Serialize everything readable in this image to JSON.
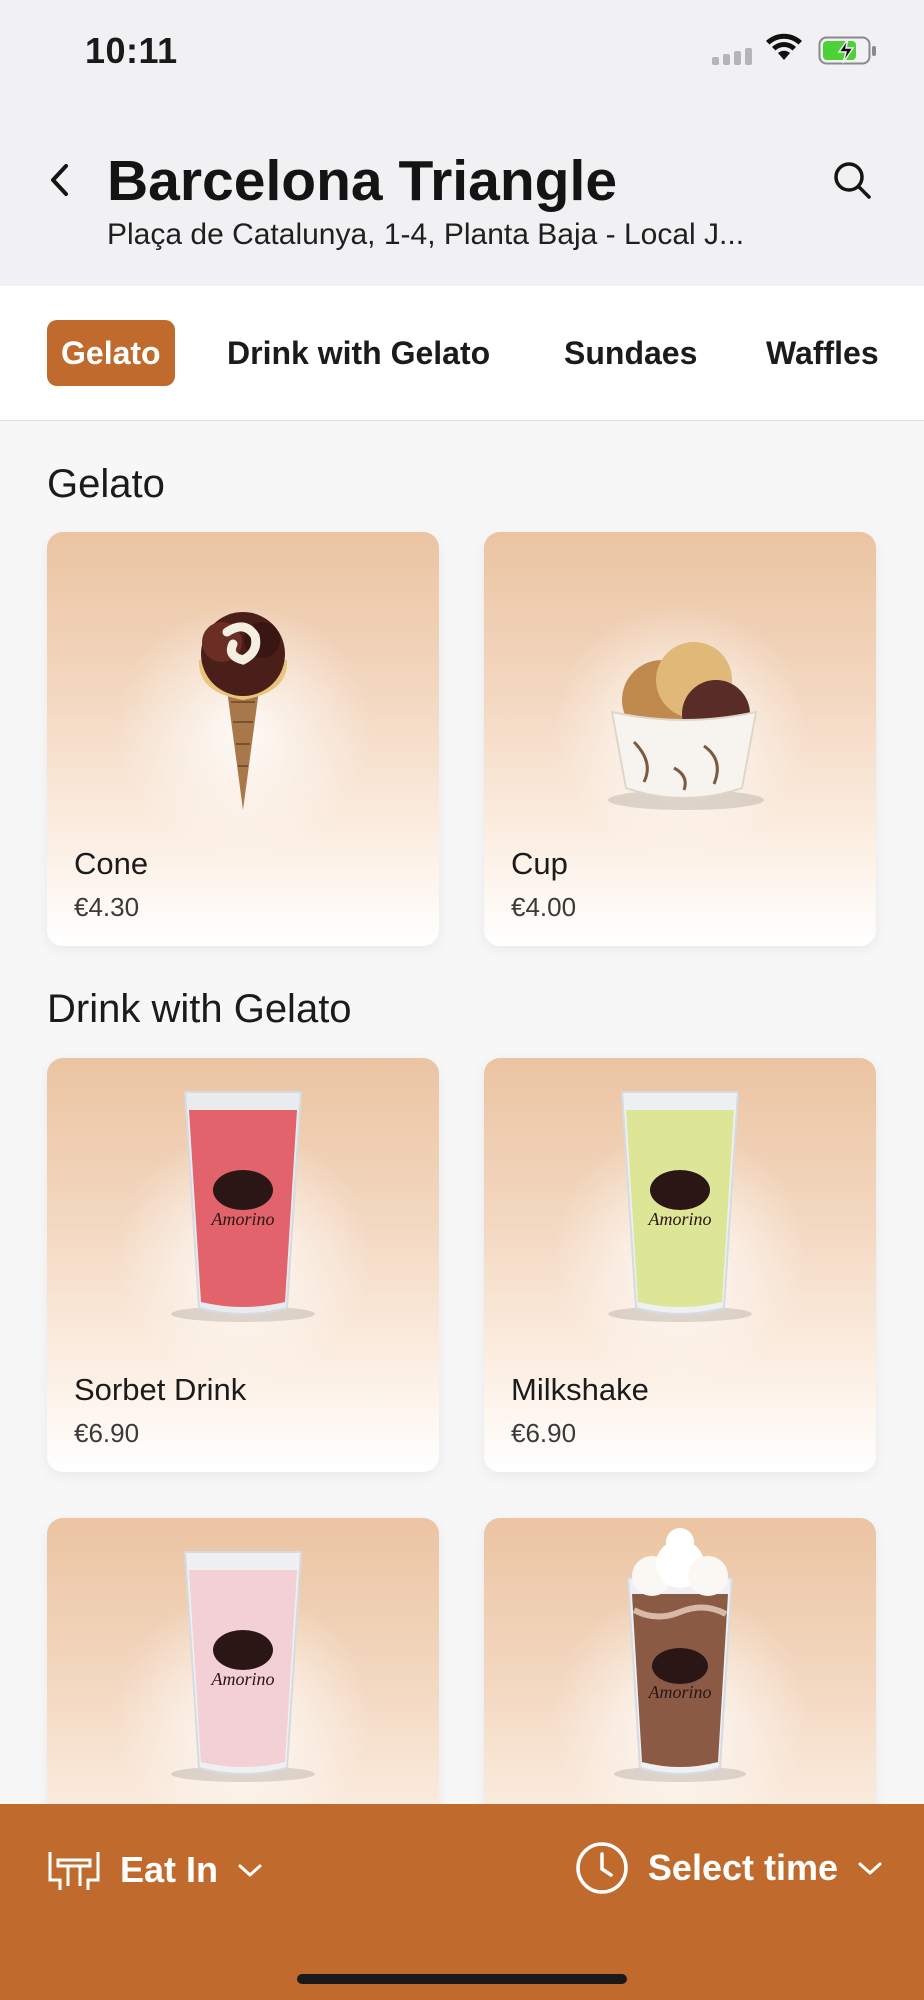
{
  "status": {
    "time": "10:11"
  },
  "header": {
    "title": "Barcelona Triangle",
    "subtitle": "Plaça de Catalunya, 1-4, Planta Baja - Local J..."
  },
  "tabs": [
    {
      "label": "Gelato",
      "active": true
    },
    {
      "label": "Drink with Gelato",
      "active": false
    },
    {
      "label": "Sundaes",
      "active": false
    },
    {
      "label": "Waffles",
      "active": false
    }
  ],
  "sections": [
    {
      "title": "Gelato",
      "items": [
        {
          "name": "Cone",
          "price": "€4.30",
          "image": "gelato-cone-icon"
        },
        {
          "name": "Cup",
          "price": "€4.00",
          "image": "gelato-cup-icon"
        }
      ]
    },
    {
      "title": "Drink with Gelato",
      "items": [
        {
          "name": "Sorbet Drink",
          "price": "€6.90",
          "image": "red-drink-glass-icon"
        },
        {
          "name": "Milkshake",
          "price": "€6.90",
          "image": "green-drink-glass-icon"
        },
        {
          "name": "",
          "price": "",
          "image": "pink-drink-glass-icon"
        },
        {
          "name": "",
          "price": "",
          "image": "chocolate-drink-glass-icon"
        }
      ]
    }
  ],
  "bottom_bar": {
    "eat_in_label": "Eat In",
    "select_time_label": "Select time"
  },
  "brand": {
    "logo_text": "Amorino"
  },
  "colors": {
    "accent": "#c06b2d",
    "header_bg": "#f1f1f3",
    "page_bg": "#f7f7f8",
    "battery_green": "#4cd137"
  }
}
